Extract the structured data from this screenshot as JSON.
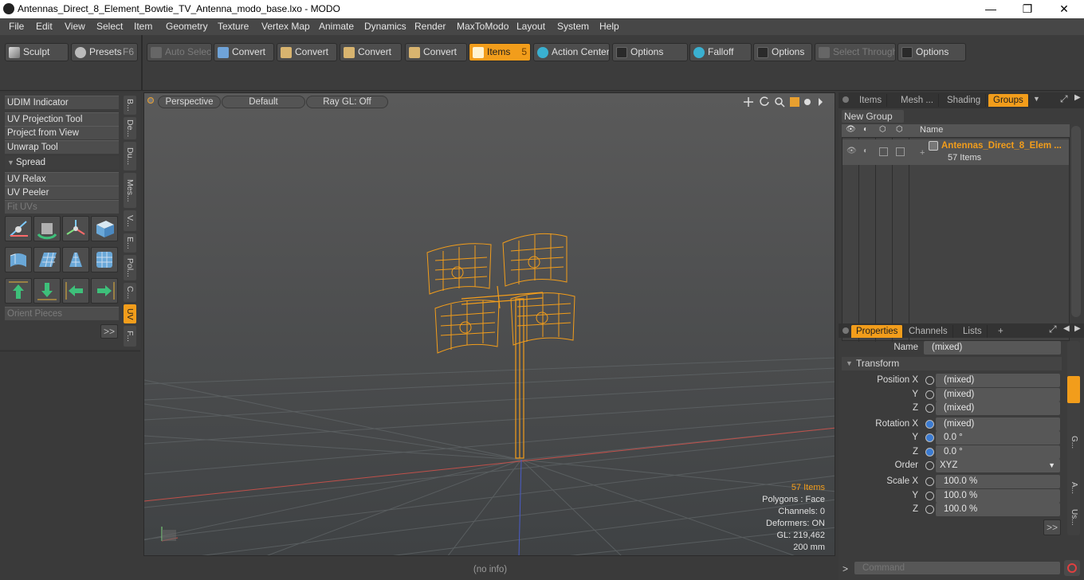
{
  "titlebar": {
    "title": "Antennas_Direct_8_Element_Bowtie_TV_Antenna_modo_base.lxo - MODO",
    "minimize": "—",
    "maximize": "❐",
    "close": "✕"
  },
  "menu": [
    "File",
    "Edit",
    "View",
    "Select",
    "Item",
    "Geometry",
    "Texture",
    "Vertex Map",
    "Animate",
    "Dynamics",
    "Render",
    "MaxToModo",
    "Layout",
    "System",
    "Help"
  ],
  "toolbar": {
    "sculpt": "Sculpt",
    "presets": "Presets",
    "presets_key": "F6",
    "auto_select": "Auto Select",
    "convert1": "Convert",
    "convert2": "Convert",
    "convert3": "Convert",
    "convert4": "Convert",
    "items": "Items",
    "items_key": "5",
    "action_center": "Action Center",
    "options1": "Options",
    "falloff": "Falloff",
    "options2": "Options",
    "select_through": "Select Through",
    "options3": "Options"
  },
  "left_panel": {
    "udim": "UDIM Indicator",
    "uv_projection": "UV Projection Tool",
    "project_from_view": "Project from View",
    "unwrap": "Unwrap Tool",
    "spread": "Spread",
    "uv_relax": "UV Relax",
    "uv_peeler": "UV Peeler",
    "fit_uvs": "Fit UVs",
    "orient_pieces": "Orient Pieces",
    "more": ">>",
    "vtabs": [
      "B...",
      "De...",
      "Du...",
      "Mes...",
      "V...",
      "E...",
      "Pol...",
      "C...",
      "UV",
      "F..."
    ]
  },
  "viewport": {
    "perspective": "Perspective",
    "default": "Default",
    "raygl": "Ray GL: Off",
    "stats": {
      "items": "57 Items",
      "polygons": "Polygons : Face",
      "channels": "Channels: 0",
      "deformers": "Deformers: ON",
      "gl": "GL: 219,462",
      "scale": "200 mm"
    }
  },
  "status": {
    "info": "(no info)"
  },
  "groups_panel": {
    "tabs": [
      "Items",
      "Mesh ...",
      "Shading",
      "Groups"
    ],
    "new_group": "New Group",
    "col_name": "Name",
    "group_name": "Antennas_Direct_8_Elem ...",
    "group_count": "57 Items"
  },
  "properties_panel": {
    "tabs": [
      "Properties",
      "Channels",
      "Lists",
      "+"
    ],
    "name_label": "Name",
    "name_value": "(mixed)",
    "transform": "Transform",
    "position_x_label": "Position X",
    "y_label": "Y",
    "z_label": "Z",
    "position_x": "(mixed)",
    "position_y": "(mixed)",
    "position_z": "(mixed)",
    "rotation_x_label": "Rotation X",
    "rotation_x": "(mixed)",
    "rotation_y": "0.0 °",
    "rotation_z": "0.0 °",
    "order_label": "Order",
    "order_value": "XYZ",
    "scale_x_label": "Scale X",
    "scale_x": "100.0 %",
    "scale_y": "100.0 %",
    "scale_z": "100.0 %",
    "more": ">>",
    "side_tabs": [
      "G...",
      "A...",
      "Us..."
    ]
  },
  "command": {
    "placeholder": "Command",
    "prompt": ">"
  }
}
